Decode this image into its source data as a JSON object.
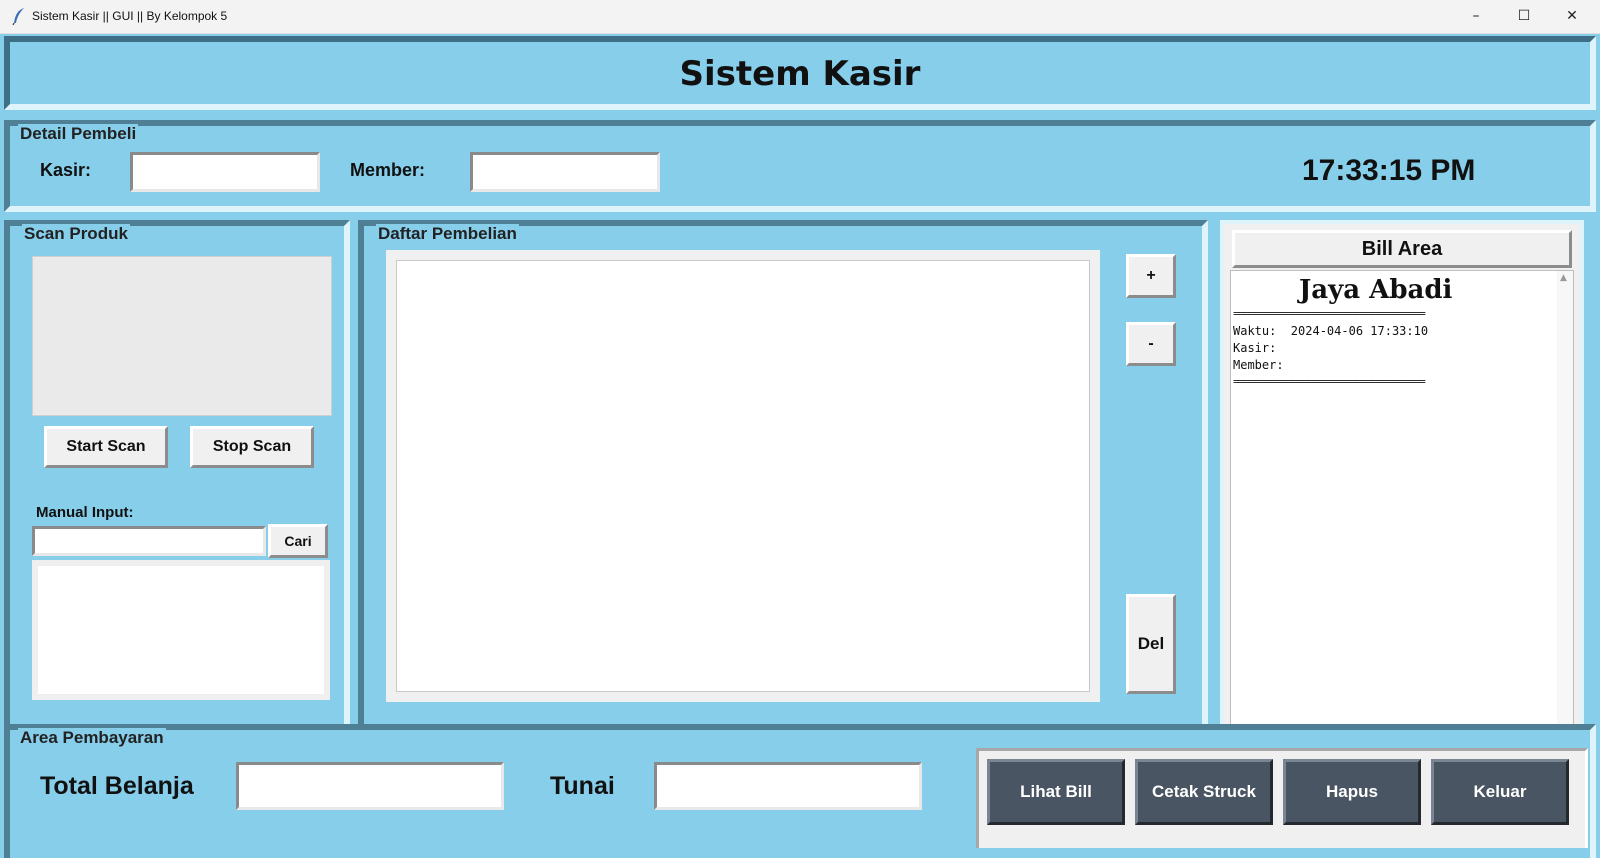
{
  "window": {
    "title": "Sistem Kasir || GUI || By Kelompok 5",
    "minimize": "–",
    "maximize": "☐",
    "close": "✕"
  },
  "header": {
    "title": "Sistem Kasir"
  },
  "detail": {
    "group_label": "Detail Pembeli",
    "kasir_label": "Kasir:",
    "kasir_value": "",
    "member_label": "Member:",
    "member_value": "",
    "clock": "17:33:15 PM"
  },
  "scan": {
    "group_label": "Scan Produk",
    "start_label": "Start Scan",
    "stop_label": "Stop Scan",
    "manual_label": "Manual Input:",
    "manual_value": "",
    "cari_label": "Cari"
  },
  "daftar": {
    "group_label": "Daftar Pembelian",
    "plus_label": "+",
    "minus_label": "-",
    "del_label": "Del"
  },
  "bill": {
    "header_label": "Bill Area",
    "store_name": "Jaya Abadi",
    "separator": "====================================",
    "waktu_line": "Waktu:  2024-04-06 17:33:10",
    "kasir_line": "Kasir:",
    "member_line": "Member:"
  },
  "payment": {
    "group_label": "Area Pembayaran",
    "total_label": "Total Belanja",
    "total_value": "",
    "tunai_label": "Tunai",
    "tunai_value": "",
    "buttons": [
      "Lihat Bill",
      "Cetak Struck",
      "Hapus",
      "Keluar"
    ]
  }
}
